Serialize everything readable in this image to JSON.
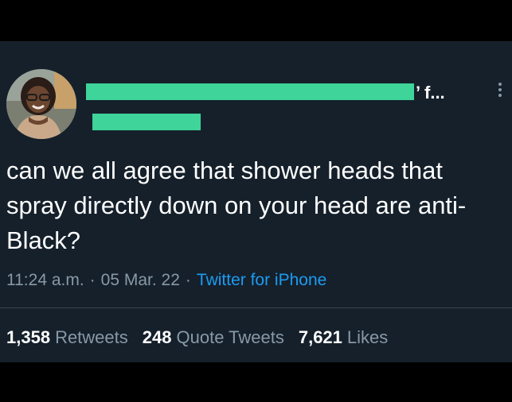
{
  "tweet": {
    "author_name_suffix": "’ f...",
    "text": "can we all agree that shower heads that spray directly down on your head are anti-Black?",
    "time": "11:24 a.m.",
    "date": "05 Mar. 22",
    "separator": "·",
    "source": "Twitter for iPhone"
  },
  "stats": {
    "retweets": {
      "count": "1,358",
      "label": "Retweets"
    },
    "quote_tweets": {
      "count": "248",
      "label": "Quote Tweets"
    },
    "likes": {
      "count": "7,621",
      "label": "Likes"
    }
  },
  "colors": {
    "background": "#15202b",
    "redaction": "#3ed49a",
    "link": "#1d9bf0",
    "secondary_text": "#8899a6"
  },
  "icons": {
    "more": "more-vertical-icon"
  }
}
